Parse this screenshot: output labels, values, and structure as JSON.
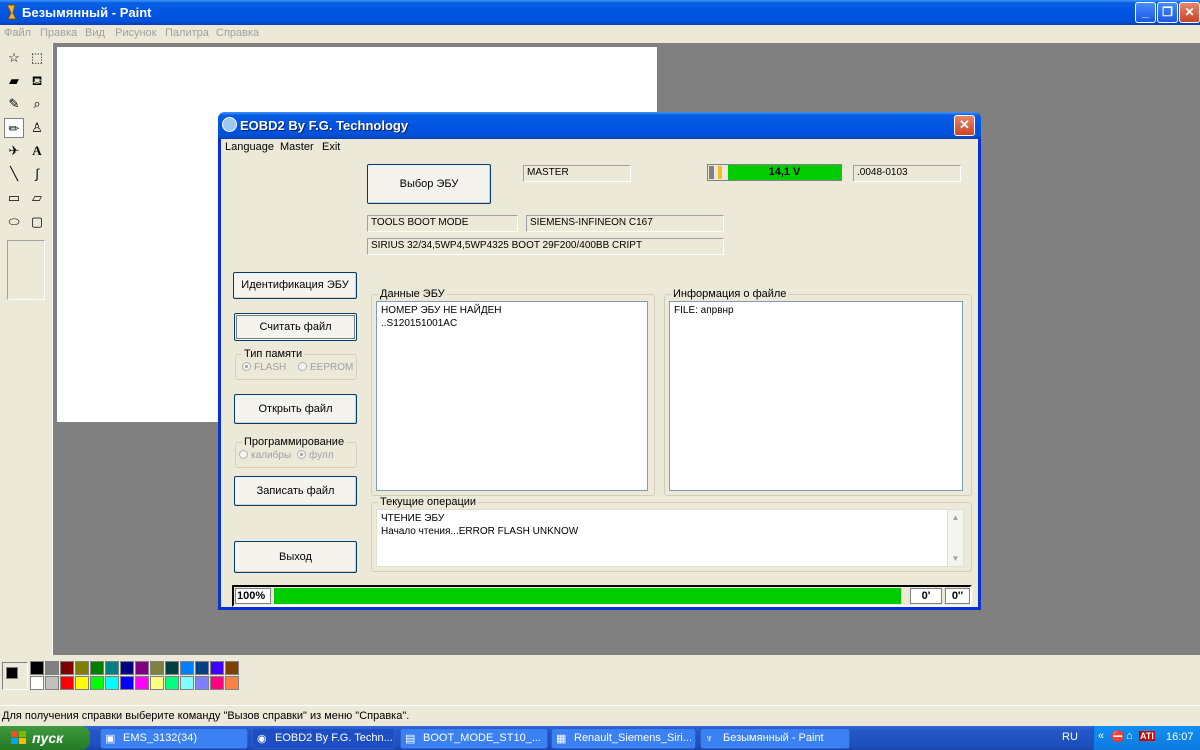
{
  "paint": {
    "title": "Безымянный - Paint",
    "menu": [
      "Файл",
      "Правка",
      "Вид",
      "Рисунок",
      "Палитра",
      "Справка"
    ],
    "status": "Для получения справки выберите команду \"Вызов справки\" из меню \"Справка\".",
    "palette_top": [
      "#000000",
      "#808080",
      "#800000",
      "#808000",
      "#008000",
      "#008080",
      "#000080",
      "#800080",
      "#808040",
      "#004040",
      "#0080ff",
      "#004080",
      "#4000ff",
      "#804000"
    ],
    "palette_bottom": [
      "#ffffff",
      "#c0c0c0",
      "#ff0000",
      "#ffff00",
      "#00ff00",
      "#00ffff",
      "#0000ff",
      "#ff00ff",
      "#ffff80",
      "#00ff80",
      "#80ffff",
      "#8080ff",
      "#ff0080",
      "#ff8040"
    ]
  },
  "dialog": {
    "title": "EOBD2 By F.G. Technology",
    "close_glyph": "✕",
    "menu": {
      "language": "Language",
      "master": "Master",
      "exit": "Exit"
    },
    "select_ecu_button": "Выбор ЭБУ",
    "master_field": "MASTER",
    "voltage": "14,1 V",
    "version_field": ".0048-0103",
    "boot_mode_field": "TOOLS BOOT MODE",
    "cpu_field": "SIEMENS-INFINEON C167",
    "ecu_desc_field": "SIRIUS 32/34,5WP4,5WP4325  BOOT  29F200/400BB CRIPT",
    "buttons": {
      "identify": "Идентификация ЭБУ",
      "read_file": "Считать файл",
      "open_file": "Открыть файл",
      "write_file": "Записать файл",
      "exit": "Выход"
    },
    "memory_type": {
      "legend": "Тип памяти",
      "flash": "FLASH",
      "eeprom": "EEPROM",
      "selected": "flash"
    },
    "programming": {
      "legend": "Программирование",
      "calib": "калибры",
      "full": "фулл",
      "selected": "full"
    },
    "ecu_data": {
      "legend": "Данные ЭБУ",
      "lines": [
        "НОМЕР ЭБУ НЕ НАЙДЕН",
        "..S120151001AC"
      ]
    },
    "file_info": {
      "legend": "Информация о файле",
      "lines": [
        "FILE: апрвнр"
      ]
    },
    "current_ops": {
      "legend": "Текущие операции",
      "lines": [
        "ЧТЕНИЕ ЭБУ",
        "Начало чтения...ERROR FLASH UNKNOW"
      ]
    },
    "progress": {
      "percent_label": "100%",
      "value": 1.0,
      "time1": "0'",
      "time2": "0''"
    }
  },
  "taskbar": {
    "start": "пуск",
    "tasks": [
      {
        "label": "EMS_3132(34)",
        "icon": "window-icon"
      },
      {
        "label": "EOBD2 By F.G. Techn...",
        "icon": "eobd-icon"
      },
      {
        "label": "BOOT_MODE_ST10_...",
        "icon": "folder-icon"
      },
      {
        "label": "Renault_Siemens_Siri...",
        "icon": "image-icon"
      },
      {
        "label": "Безымянный - Paint",
        "icon": "paint-icon"
      }
    ],
    "lang": "RU",
    "clock": "16:07"
  }
}
